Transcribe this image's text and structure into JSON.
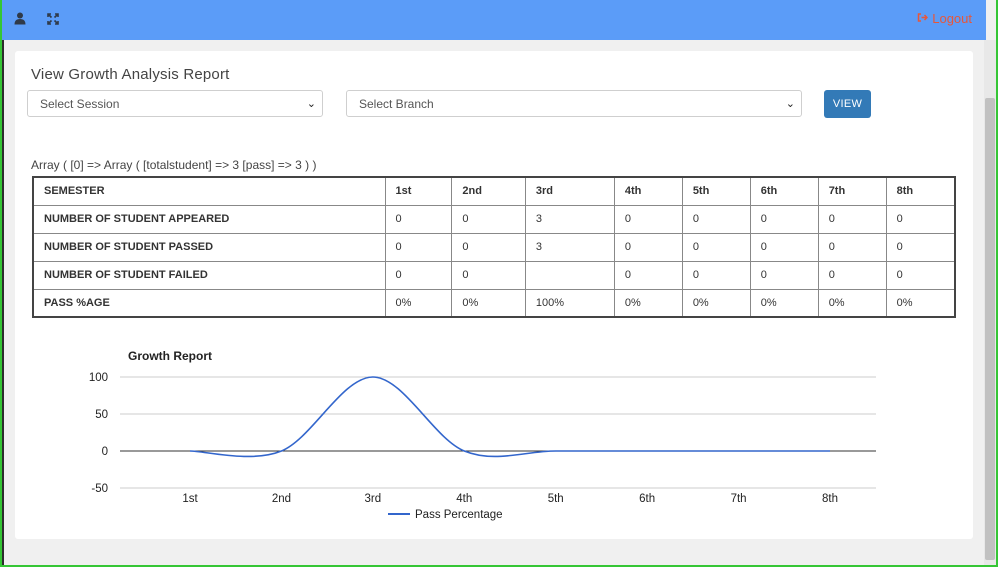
{
  "header": {
    "user_icon": "user-icon",
    "expand_icon": "expand-icon",
    "logout_label": "Logout",
    "logout_color": "#e8573a",
    "bar_color": "#5b9cf8"
  },
  "page": {
    "title": "View Growth Analysis Report",
    "session_select": {
      "selected": "Select Session"
    },
    "branch_select": {
      "selected": "Select Branch"
    },
    "view_label": "VIEW",
    "debug_text": "Array ( [0] => Array ( [totalstudent] => 3 [pass] => 3 ) )"
  },
  "table": {
    "header": [
      "SEMESTER",
      "1st",
      "2nd",
      "3rd",
      "4th",
      "5th",
      "6th",
      "7th",
      "8th"
    ],
    "rows": [
      [
        "NUMBER OF STUDENT APPEARED",
        "0",
        "0",
        "3",
        "0",
        "0",
        "0",
        "0",
        "0"
      ],
      [
        "NUMBER OF STUDENT PASSED",
        "0",
        "0",
        "3",
        "0",
        "0",
        "0",
        "0",
        "0"
      ],
      [
        "NUMBER OF STUDENT FAILED",
        "0",
        "0",
        "",
        "0",
        "0",
        "0",
        "0",
        "0"
      ],
      [
        "PASS %AGE",
        "0%",
        "0%",
        "100%",
        "0%",
        "0%",
        "0%",
        "0%",
        "0%"
      ]
    ]
  },
  "chart_data": {
    "type": "line",
    "title": "Growth Report",
    "categories": [
      "1st",
      "2nd",
      "3rd",
      "4th",
      "5th",
      "6th",
      "7th",
      "8th"
    ],
    "series": [
      {
        "name": "Pass Percentage",
        "values": [
          0,
          0,
          100,
          0,
          0,
          0,
          0,
          0
        ],
        "color": "#3366cc"
      }
    ],
    "yticks": [
      100,
      50,
      0,
      -50
    ],
    "ylim": [
      -50,
      100
    ],
    "grid": true,
    "legend": "bottom"
  }
}
